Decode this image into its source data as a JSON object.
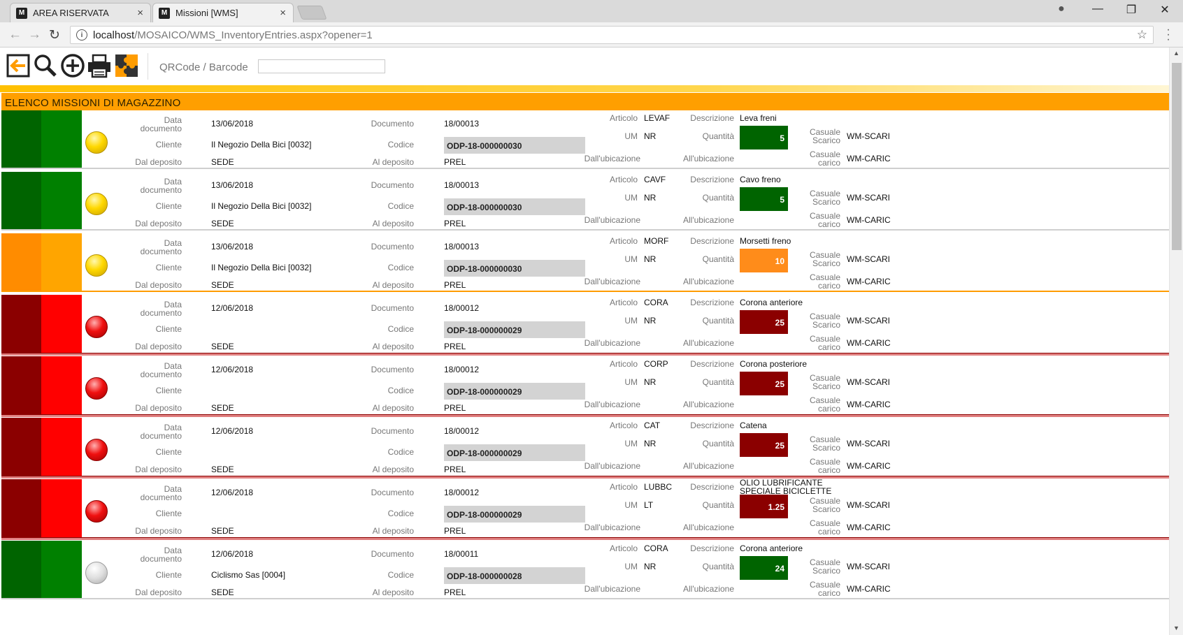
{
  "browser": {
    "tabs": [
      {
        "favicon": "M",
        "title": "AREA RISERVATA",
        "close": "×"
      },
      {
        "favicon": "M",
        "title": "Missioni [WMS]",
        "close": "×"
      }
    ],
    "url_host": "localhost",
    "url_path": "/MOSAICO/WMS_InventoryEntries.aspx?opener=1",
    "info": "i",
    "nav": {
      "back": "←",
      "forward": "→",
      "reload": "↻"
    },
    "star": "☆",
    "window": {
      "profile": "●",
      "minimize": "—",
      "restore": "❐",
      "close": "✕"
    }
  },
  "toolbar": {
    "icons": [
      "back-arrow-icon",
      "search-icon",
      "add-icon",
      "print-icon",
      "puzzle-icon"
    ],
    "qr_label": "QRCode / Barcode",
    "qr_value": ""
  },
  "page_title": "ELENCO MISSIONI DI MAGAZZINO",
  "labels": {
    "data": "Data",
    "documento_sub": "documento",
    "cliente": "Cliente",
    "dal_deposito": "Dal deposito",
    "documento": "Documento",
    "codice": "Codice",
    "al_deposito": "Al deposito",
    "articolo": "Articolo",
    "um": "UM",
    "dallubicazione": "Dall'ubicazione",
    "descrizione": "Descrizione",
    "quantita": "Quantità",
    "allubicazione": "All'ubicazione",
    "casuale": "Casuale",
    "scarico": "Scarico",
    "carico": "carico"
  },
  "colors": {
    "green_dark": "#006400",
    "green": "#008000",
    "orange_dark": "#ff8c00",
    "orange": "#ffa500",
    "red_dark": "#8b0000",
    "red": "#ff0000",
    "qty_orange": "#ff8c1a"
  },
  "rows": [
    {
      "status": "green",
      "light": "yellow",
      "date": "13/06/2018",
      "cliente": "Il Negozio Della Bici [0032]",
      "deposito": "SEDE",
      "documento": "18/00013",
      "codice": "ODP-18-000000030",
      "al_deposito": "PREL",
      "articolo": "LEVAF",
      "um": "NR",
      "descrizione": "Leva freni",
      "quantita": "5",
      "casuale_scarico": "WM-SCARI",
      "casuale_carico": "WM-CARIC"
    },
    {
      "status": "green",
      "light": "yellow",
      "date": "13/06/2018",
      "cliente": "Il Negozio Della Bici [0032]",
      "deposito": "SEDE",
      "documento": "18/00013",
      "codice": "ODP-18-000000030",
      "al_deposito": "PREL",
      "articolo": "CAVF",
      "um": "NR",
      "descrizione": "Cavo freno",
      "quantita": "5",
      "casuale_scarico": "WM-SCARI",
      "casuale_carico": "WM-CARIC"
    },
    {
      "status": "orange",
      "light": "yellow",
      "date": "13/06/2018",
      "cliente": "Il Negozio Della Bici [0032]",
      "deposito": "SEDE",
      "documento": "18/00013",
      "codice": "ODP-18-000000030",
      "al_deposito": "PREL",
      "articolo": "MORF",
      "um": "NR",
      "descrizione": "Morsetti freno",
      "quantita": "10",
      "casuale_scarico": "WM-SCARI",
      "casuale_carico": "WM-CARIC"
    },
    {
      "status": "red",
      "light": "red",
      "date": "12/06/2018",
      "cliente": "",
      "deposito": "SEDE",
      "documento": "18/00012",
      "codice": "ODP-18-000000029",
      "al_deposito": "PREL",
      "articolo": "CORA",
      "um": "NR",
      "descrizione": "Corona anteriore",
      "quantita": "25",
      "casuale_scarico": "WM-SCARI",
      "casuale_carico": "WM-CARIC"
    },
    {
      "status": "red",
      "light": "red",
      "date": "12/06/2018",
      "cliente": "",
      "deposito": "SEDE",
      "documento": "18/00012",
      "codice": "ODP-18-000000029",
      "al_deposito": "PREL",
      "articolo": "CORP",
      "um": "NR",
      "descrizione": "Corona posteriore",
      "quantita": "25",
      "casuale_scarico": "WM-SCARI",
      "casuale_carico": "WM-CARIC"
    },
    {
      "status": "red",
      "light": "red",
      "date": "12/06/2018",
      "cliente": "",
      "deposito": "SEDE",
      "documento": "18/00012",
      "codice": "ODP-18-000000029",
      "al_deposito": "PREL",
      "articolo": "CAT",
      "um": "NR",
      "descrizione": "Catena",
      "quantita": "25",
      "casuale_scarico": "WM-SCARI",
      "casuale_carico": "WM-CARIC"
    },
    {
      "status": "red",
      "light": "red",
      "date": "12/06/2018",
      "cliente": "",
      "deposito": "SEDE",
      "documento": "18/00012",
      "codice": "ODP-18-000000029",
      "al_deposito": "PREL",
      "articolo": "LUBBC",
      "um": "LT",
      "descrizione": "OLIO LUBRIFICANTE SPECIALE BICICLETTE",
      "quantita": "1.25",
      "casuale_scarico": "WM-SCARI",
      "casuale_carico": "WM-CARIC"
    },
    {
      "status": "green",
      "light": "gray",
      "date": "12/06/2018",
      "cliente": "Ciclismo Sas [0004]",
      "deposito": "SEDE",
      "documento": "18/00011",
      "codice": "ODP-18-000000028",
      "al_deposito": "PREL",
      "articolo": "CORA",
      "um": "NR",
      "descrizione": "Corona anteriore",
      "quantita": "24",
      "casuale_scarico": "WM-SCARI",
      "casuale_carico": "WM-CARIC"
    }
  ]
}
